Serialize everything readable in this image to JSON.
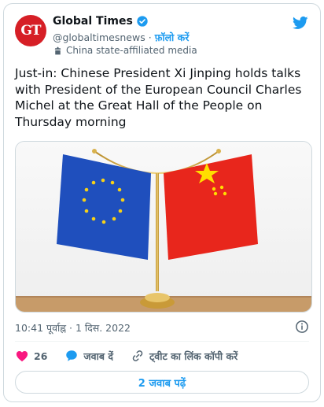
{
  "author": {
    "avatar_text": "GT",
    "name": "Global Times",
    "handle": "@globaltimesnews",
    "separator": "·",
    "follow_label": "फ़ॉलो करें",
    "affiliation": "China state-affiliated media"
  },
  "tweet": {
    "text": "Just-in: Chinese President Xi Jinping holds talks with President of the European Council Charles Michel at the Great Hall of the People on Thursday morning",
    "timestamp": "10:41 पूर्वाह्न · 1 दिस. 2022"
  },
  "actions": {
    "like_count": "26",
    "reply_label": "जवाब दें",
    "copy_link_label": "ट्वीट का लिंक कॉपी करें"
  },
  "replies_button": {
    "label": "2 जवाब पढ़ें"
  },
  "colors": {
    "brand_red": "#d61f26",
    "twitter_blue": "#1d9bf0",
    "like_pink": "#f91880",
    "eu_blue": "#1f4fbd",
    "china_red": "#e8261c",
    "gold": "#d9b24c"
  },
  "icons": [
    "verified-badge-icon",
    "twitter-bird-icon",
    "state-media-icon",
    "info-icon",
    "heart-icon",
    "reply-bubble-icon",
    "link-icon"
  ]
}
